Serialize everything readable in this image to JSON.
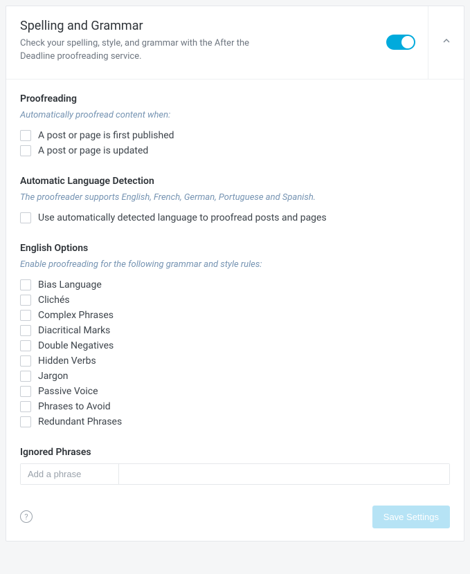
{
  "header": {
    "title": "Spelling and Grammar",
    "subtitle": "Check your spelling, style, and grammar with the After the Deadline proofreading service.",
    "toggle_on": true
  },
  "sections": {
    "proofreading": {
      "heading": "Proofreading",
      "note": "Automatically proofread content when:",
      "items": [
        "A post or page is first published",
        "A post or page is updated"
      ]
    },
    "auto_lang": {
      "heading": "Automatic Language Detection",
      "note": "The proofreader supports English, French, German, Portuguese and Spanish.",
      "items": [
        "Use automatically detected language to proofread posts and pages"
      ]
    },
    "english": {
      "heading": "English Options",
      "note": "Enable proofreading for the following grammar and style rules:",
      "items": [
        "Bias Language",
        "Clichés",
        "Complex Phrases",
        "Diacritical Marks",
        "Double Negatives",
        "Hidden Verbs",
        "Jargon",
        "Passive Voice",
        "Phrases to Avoid",
        "Redundant Phrases"
      ]
    },
    "ignored": {
      "heading": "Ignored Phrases",
      "placeholder": "Add a phrase"
    }
  },
  "footer": {
    "help_label": "?",
    "save_label": "Save Settings"
  }
}
